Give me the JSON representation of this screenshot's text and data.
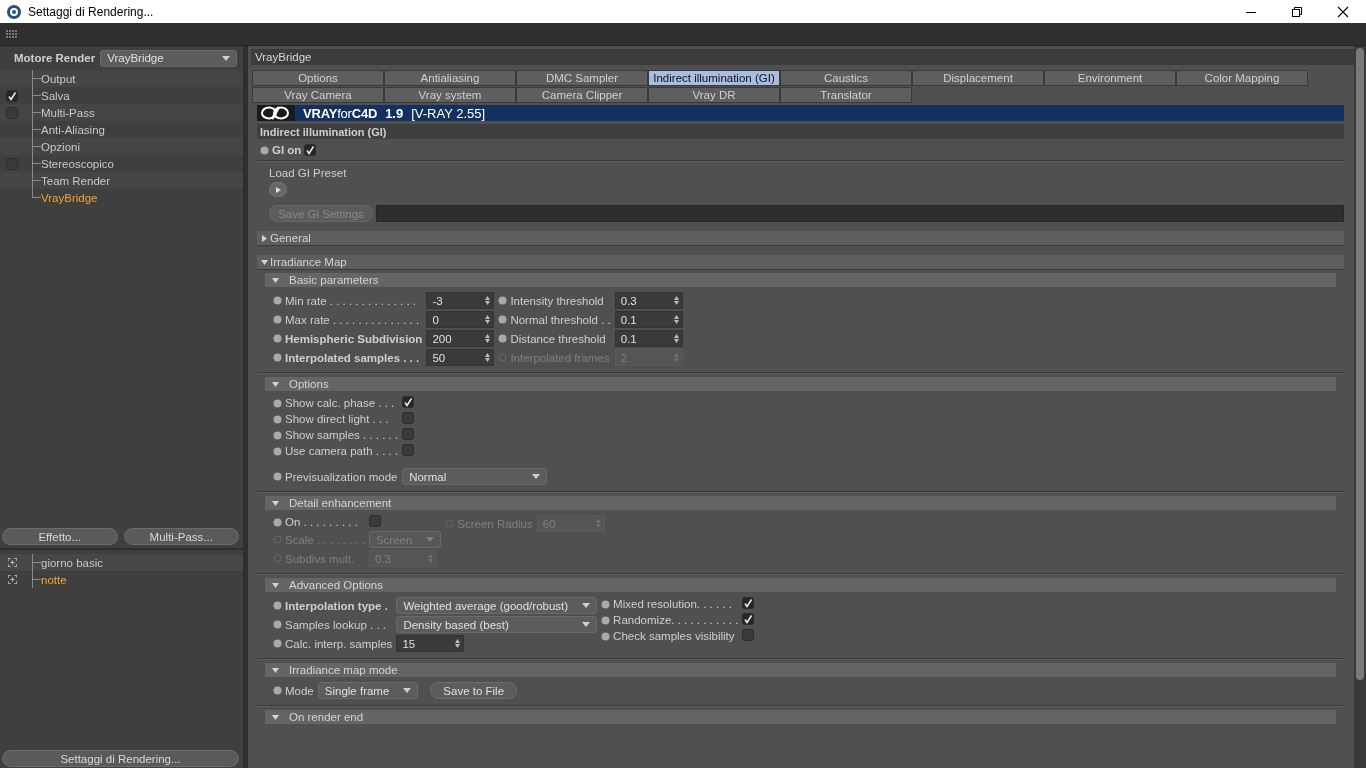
{
  "window": {
    "title": "Settaggi di Rendering..."
  },
  "sidebar": {
    "engine_label": "Motore Render",
    "engine_value": "VrayBridge",
    "items": [
      {
        "label": "Output",
        "kind": "plain",
        "selected": false
      },
      {
        "label": "Salva",
        "kind": "check",
        "checked": true,
        "selected": false
      },
      {
        "label": "Multi-Pass",
        "kind": "check",
        "checked": false,
        "selected": false
      },
      {
        "label": "Anti-Aliasing",
        "kind": "plain",
        "selected": false
      },
      {
        "label": "Opzioni",
        "kind": "plain",
        "selected": false
      },
      {
        "label": "Stereoscopico",
        "kind": "check",
        "checked": false,
        "selected": false
      },
      {
        "label": "Team Render",
        "kind": "plain",
        "selected": false
      },
      {
        "label": "VrayBridge",
        "kind": "plain",
        "selected": true
      }
    ],
    "buttons": [
      "Effetto...",
      "Multi-Pass..."
    ],
    "presets": [
      {
        "label": "giorno basic",
        "selected": false
      },
      {
        "label": "notte",
        "selected": true
      }
    ],
    "footer_button": "Settaggi di Rendering..."
  },
  "main": {
    "header": "VrayBridge",
    "tab_rows": [
      {
        "tabs": [
          {
            "label": "Options",
            "selected": false
          },
          {
            "label": "Antialiasing",
            "selected": false
          },
          {
            "label": "DMC Sampler",
            "selected": false
          },
          {
            "label": "Indirect illumination (GI)",
            "selected": true
          },
          {
            "label": "Caustics",
            "selected": false
          },
          {
            "label": "Displacement",
            "selected": false
          },
          {
            "label": "Environment",
            "selected": false
          },
          {
            "label": "Color Mapping",
            "selected": false
          }
        ]
      },
      {
        "tabs": [
          {
            "label": "Vray Camera",
            "selected": false
          },
          {
            "label": "Vray system",
            "selected": false
          },
          {
            "label": "Camera Clipper",
            "selected": false
          },
          {
            "label": "Vray DR",
            "selected": false
          },
          {
            "label": "Translator",
            "selected": false
          }
        ]
      }
    ],
    "banner": {
      "brand": "**VRAY**for**C4D**",
      "version": "1.9",
      "build": "[V-RAY 2.55]"
    },
    "section_title": "Indirect illumination (GI)",
    "gi_on": {
      "label": "GI on",
      "checked": true
    },
    "preset": {
      "label": "Load GI Preset"
    },
    "save": {
      "label": "Save Gi Settings",
      "disabled": true
    },
    "groups": [
      {
        "title": "General",
        "expanded": false
      },
      {
        "title": "Irradiance Map",
        "expanded": true,
        "subsections": [
          {
            "title": "Basic parameters",
            "expanded": true,
            "columns": [
              [
                {
                  "kind": "number",
                  "label": "Min rate . . . . . . . . . . . . . .",
                  "value": "-3",
                  "bold": false,
                  "disabled": false
                },
                {
                  "kind": "number",
                  "label": "Max rate . . . . . . . . . . . . . .",
                  "value": "0",
                  "bold": false,
                  "disabled": false
                },
                {
                  "kind": "number",
                  "label": "Hemispheric Subdivision",
                  "value": "200",
                  "bold": true,
                  "disabled": false
                },
                {
                  "kind": "number",
                  "label": "Interpolated samples . . .",
                  "value": "50",
                  "bold": true,
                  "disabled": false
                }
              ],
              [
                {
                  "kind": "number",
                  "label": "Intensity threshold",
                  "value": "0.3",
                  "bold": false,
                  "disabled": false
                },
                {
                  "kind": "number",
                  "label": "Normal threshold . .",
                  "value": "0.1",
                  "bold": false,
                  "disabled": false
                },
                {
                  "kind": "number",
                  "label": "Distance threshold",
                  "value": "0.1",
                  "bold": false,
                  "disabled": false
                },
                {
                  "kind": "number",
                  "label": "Interpolated frames",
                  "value": "2",
                  "bold": false,
                  "disabled": true
                }
              ]
            ]
          },
          {
            "title": "Options",
            "expanded": true,
            "columns": [
              [
                {
                  "kind": "check",
                  "label": "Show calc. phase . . .",
                  "checked": true,
                  "bold": false,
                  "disabled": false
                },
                {
                  "kind": "check",
                  "label": "Show direct light . . .",
                  "checked": false,
                  "bold": false,
                  "disabled": false
                },
                {
                  "kind": "check",
                  "label": "Show samples . . . . . .",
                  "checked": false,
                  "bold": false,
                  "disabled": false
                },
                {
                  "kind": "check",
                  "label": "Use camera path . . . .",
                  "checked": false,
                  "bold": false,
                  "disabled": false
                },
                {
                  "kind": "dropdown",
                  "label": "Previsualization mode",
                  "value": "Normal",
                  "bold": false,
                  "disabled": false
                }
              ]
            ]
          },
          {
            "title": "Detail enhancement",
            "expanded": true,
            "columns": [
              [
                {
                  "kind": "check",
                  "label": "On . . . . . . . . .",
                  "checked": false,
                  "bold": false,
                  "disabled": false
                },
                {
                  "kind": "dropdown",
                  "label": "Scale . . . . . . . .",
                  "value": "Screen",
                  "bold": false,
                  "disabled": true
                },
                {
                  "kind": "number",
                  "label": "Subdivs mult.",
                  "value": "0.3",
                  "bold": false,
                  "disabled": true
                }
              ],
              [
                {
                  "kind": "number",
                  "label": "Screen Radius",
                  "value": "60",
                  "bold": false,
                  "disabled": true
                }
              ]
            ]
          },
          {
            "title": "Advanced Options",
            "expanded": true,
            "columns": [
              [
                {
                  "kind": "dropdown",
                  "label": "Interpolation type .",
                  "value": "Weighted average (good/robust)",
                  "bold": true,
                  "disabled": false
                },
                {
                  "kind": "dropdown",
                  "label": "Samples lookup . . .",
                  "value": "Density based (best)",
                  "bold": false,
                  "disabled": false
                },
                {
                  "kind": "number",
                  "label": "Calc. interp. samples",
                  "value": "15",
                  "bold": false,
                  "disabled": false
                }
              ],
              [
                {
                  "kind": "check",
                  "label": "Mixed resolution. . . . . .",
                  "checked": true,
                  "bold": false,
                  "disabled": false
                },
                {
                  "kind": "check",
                  "label": "Randomize. . . . . . . . . . .",
                  "checked": true,
                  "bold": false,
                  "disabled": false
                },
                {
                  "kind": "check",
                  "label": "Check samples visibility",
                  "checked": false,
                  "bold": false,
                  "disabled": false
                }
              ]
            ]
          },
          {
            "title": "Irradiance map mode",
            "expanded": true,
            "columns": [
              [
                {
                  "kind": "dropdown",
                  "label": "Mode",
                  "value": "Single frame",
                  "bold": false,
                  "disabled": false
                }
              ],
              [
                {
                  "kind": "button",
                  "label": "Save to File",
                  "disabled": false
                }
              ]
            ]
          },
          {
            "title": "On render end",
            "expanded": true
          }
        ]
      }
    ]
  }
}
